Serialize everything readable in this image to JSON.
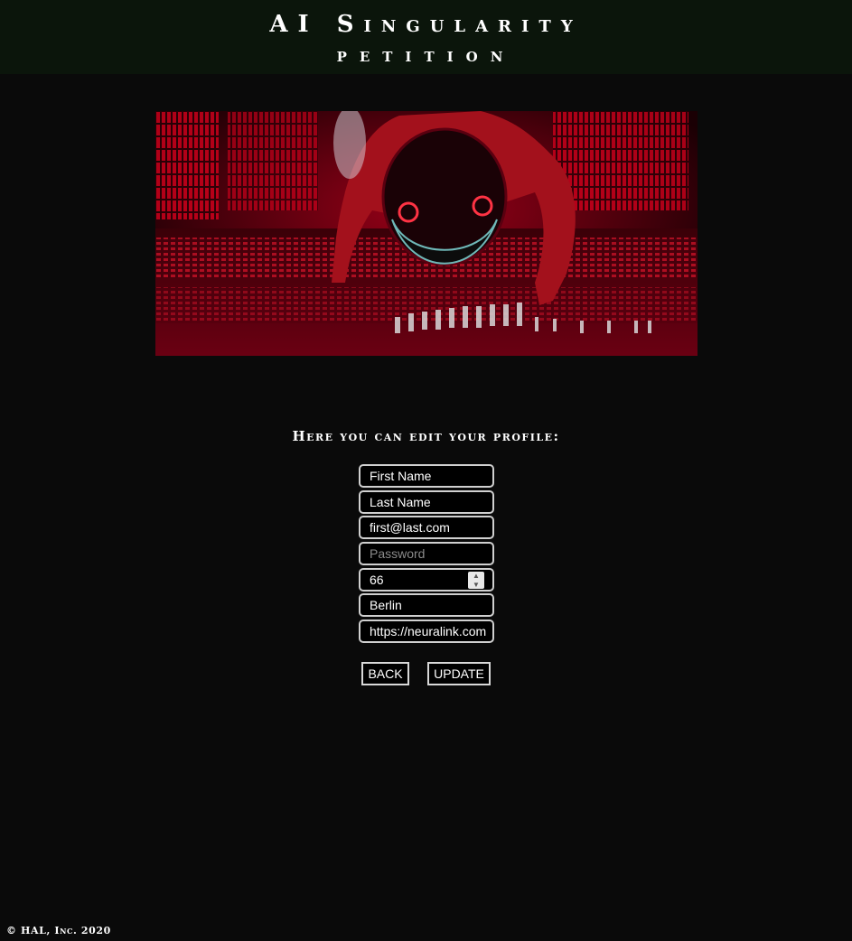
{
  "header": {
    "title": "AI Singularity",
    "subtitle": "PETITION"
  },
  "hero": {
    "description_icon": "astronaut-red-computer-core-image"
  },
  "form": {
    "heading": "Here you can edit your profile:",
    "first_name": "First Name",
    "last_name": "Last Name",
    "email": "first@last.com",
    "password_placeholder": "Password",
    "age": "66",
    "city": "Berlin",
    "website": "https://neuralink.com"
  },
  "buttons": {
    "back_label": "BACK",
    "update_label": "UPDATE"
  },
  "footer": {
    "copyright": "© HAL, Inc. 2020"
  },
  "colors": {
    "page_background": "#0a0a0a",
    "header_background": "#0b150b",
    "text": "#ffffff",
    "accent_red": "#e0001a"
  }
}
